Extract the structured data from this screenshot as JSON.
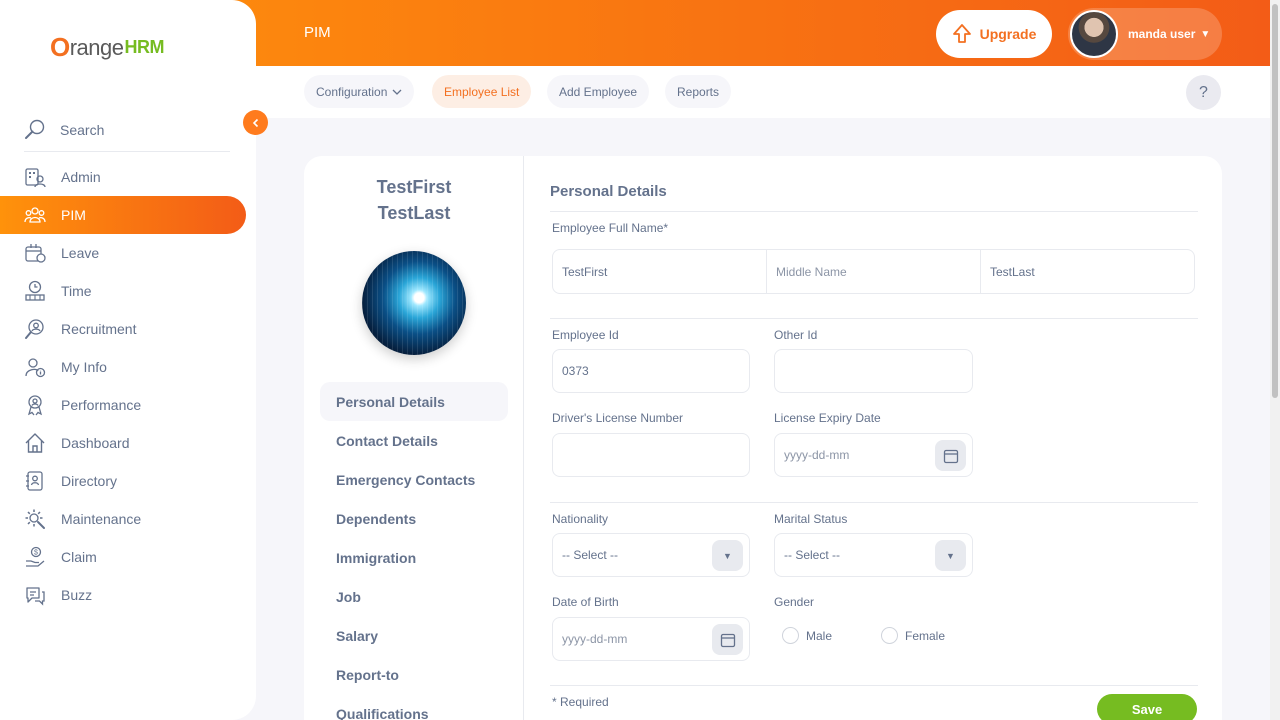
{
  "brand": {
    "prefix": "O",
    "name": "range",
    "suffix": "HRM"
  },
  "sidebar": {
    "search_label": "Search",
    "collapse_icon": "chevron-left-icon",
    "items": [
      {
        "label": "Admin",
        "icon": "admin-icon",
        "active": false
      },
      {
        "label": "PIM",
        "icon": "pim-icon",
        "active": true
      },
      {
        "label": "Leave",
        "icon": "leave-icon",
        "active": false
      },
      {
        "label": "Time",
        "icon": "time-icon",
        "active": false
      },
      {
        "label": "Recruitment",
        "icon": "recruitment-icon",
        "active": false
      },
      {
        "label": "My Info",
        "icon": "my-info-icon",
        "active": false
      },
      {
        "label": "Performance",
        "icon": "performance-icon",
        "active": false
      },
      {
        "label": "Dashboard",
        "icon": "dashboard-icon",
        "active": false
      },
      {
        "label": "Directory",
        "icon": "directory-icon",
        "active": false
      },
      {
        "label": "Maintenance",
        "icon": "maintenance-icon",
        "active": false
      },
      {
        "label": "Claim",
        "icon": "claim-icon",
        "active": false
      },
      {
        "label": "Buzz",
        "icon": "buzz-icon",
        "active": false
      }
    ]
  },
  "topbar": {
    "module": "PIM",
    "upgrade_label": "Upgrade",
    "user_name": "manda user"
  },
  "subnav": {
    "tabs": [
      {
        "label": "Configuration",
        "has_dropdown": true,
        "active": false
      },
      {
        "label": "Employee List",
        "active": true
      },
      {
        "label": "Add Employee",
        "active": false
      },
      {
        "label": "Reports",
        "active": false
      }
    ],
    "help_label": "?"
  },
  "employee": {
    "first_name": "TestFirst",
    "last_name": "TestLast"
  },
  "side_menu": [
    {
      "label": "Personal Details",
      "active": true
    },
    {
      "label": "Contact Details",
      "active": false
    },
    {
      "label": "Emergency Contacts",
      "active": false
    },
    {
      "label": "Dependents",
      "active": false
    },
    {
      "label": "Immigration",
      "active": false
    },
    {
      "label": "Job",
      "active": false
    },
    {
      "label": "Salary",
      "active": false
    },
    {
      "label": "Report-to",
      "active": false
    },
    {
      "label": "Qualifications",
      "active": false
    }
  ],
  "form": {
    "title": "Personal Details",
    "full_name_label": "Employee Full Name*",
    "first_name_value": "TestFirst",
    "middle_name_placeholder": "Middle Name",
    "last_name_value": "TestLast",
    "employee_id_label": "Employee Id",
    "employee_id_value": "0373",
    "other_id_label": "Other Id",
    "other_id_value": "",
    "license_label": "Driver's License Number",
    "license_value": "",
    "expiry_label": "License Expiry Date",
    "expiry_placeholder": "yyyy-dd-mm",
    "nationality_label": "Nationality",
    "nationality_value": "-- Select --",
    "marital_label": "Marital Status",
    "marital_value": "-- Select --",
    "dob_label": "Date of Birth",
    "dob_placeholder": "yyyy-dd-mm",
    "gender_label": "Gender",
    "gender_options": [
      "Male",
      "Female"
    ],
    "required_note": "* Required",
    "save_label": "Save"
  },
  "colors": {
    "accent": "#f37021",
    "accent_gradient_start": "#ff920b",
    "accent_gradient_end": "#f35c17",
    "success": "#76bc21",
    "text": "#64728c"
  }
}
